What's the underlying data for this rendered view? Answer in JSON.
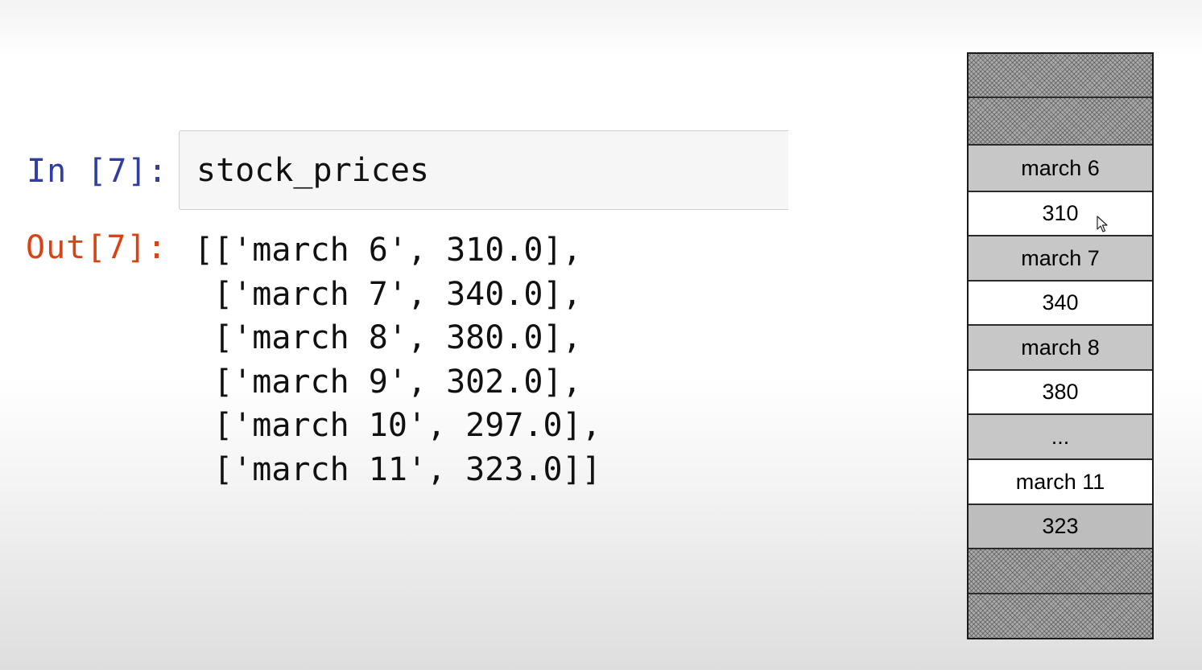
{
  "notebook": {
    "input_prompt": "In [7]:",
    "input_code": "stock_prices",
    "output_prompt": "Out[7]:",
    "output_lines": [
      "[['march 6', 310.0],",
      " ['march 7', 340.0],",
      " ['march 8', 380.0],",
      " ['march 9', 302.0],",
      " ['march 10', 297.0],",
      " ['march 11', 323.0]]"
    ]
  },
  "memory_diagram": {
    "cells": [
      {
        "text": "",
        "style": "hatched"
      },
      {
        "text": "",
        "style": "hatched"
      },
      {
        "text": "march 6",
        "style": "gray"
      },
      {
        "text": "310",
        "style": "white"
      },
      {
        "text": "march 7",
        "style": "gray"
      },
      {
        "text": "340",
        "style": "white"
      },
      {
        "text": "march 8",
        "style": "gray"
      },
      {
        "text": "380",
        "style": "white"
      },
      {
        "text": "...",
        "style": "gray"
      },
      {
        "text": "march 11",
        "style": "white"
      },
      {
        "text": "323",
        "style": "gray dark"
      },
      {
        "text": "",
        "style": "hatched"
      },
      {
        "text": "",
        "style": "hatched"
      }
    ]
  },
  "colors": {
    "input_prompt": "#303f9f",
    "output_prompt": "#d84315",
    "cell_gray": "#c7c7c7",
    "cell_white": "#ffffff",
    "cell_border": "#2b2b2b"
  }
}
